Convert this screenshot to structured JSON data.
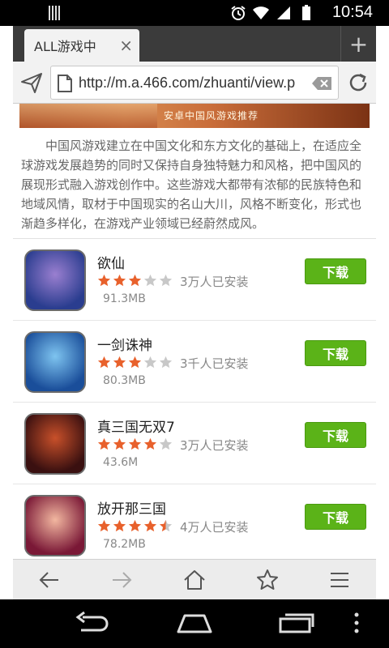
{
  "statusbar": {
    "time": "10:54",
    "icons": [
      "alarm-icon",
      "wifi-icon",
      "signal-icon",
      "battery-icon"
    ]
  },
  "tab": {
    "title": "ALL游戏中",
    "close": "×",
    "add": "+"
  },
  "addressbar": {
    "url": "http://m.a.466.com/zhuanti/view.p"
  },
  "banner": {
    "text": "安卓中国风游戏推荐"
  },
  "intro": "中国风游戏建立在中国文化和东方文化的基础上，在适应全球游戏发展趋势的同时又保持自身独特魅力和风格，把中国风的展现形式融入游戏创作中。这些游戏大都带有浓郁的民族特色和地域风情，取材于中国现实的名山大川，风格不断变化，形式也渐趋多样化，在游戏产业领域已经蔚然成风。",
  "apps": [
    {
      "name": "欲仙",
      "rating": 3,
      "installs": "3万人已安装",
      "size": "91.3MB",
      "download": "下载",
      "colors": [
        "#2a3d8f",
        "#9a7fd0"
      ]
    },
    {
      "name": "一剑诛神",
      "rating": 3,
      "installs": "3千人已安装",
      "size": "80.3MB",
      "download": "下载",
      "colors": [
        "#1a4e9a",
        "#7ec4f0"
      ]
    },
    {
      "name": "真三国无双7",
      "rating": 4,
      "installs": "3万人已安装",
      "size": "43.6M",
      "download": "下载",
      "colors": [
        "#3a1010",
        "#c8502a"
      ]
    },
    {
      "name": "放开那三国",
      "rating": 4.5,
      "installs": "4万人已安装",
      "size": "78.2MB",
      "download": "下载",
      "colors": [
        "#7a1836",
        "#f2b7a0"
      ]
    }
  ],
  "colors": {
    "accent": "#5bb318",
    "star_on": "#e8612c",
    "star_off": "#c8c8c8"
  }
}
